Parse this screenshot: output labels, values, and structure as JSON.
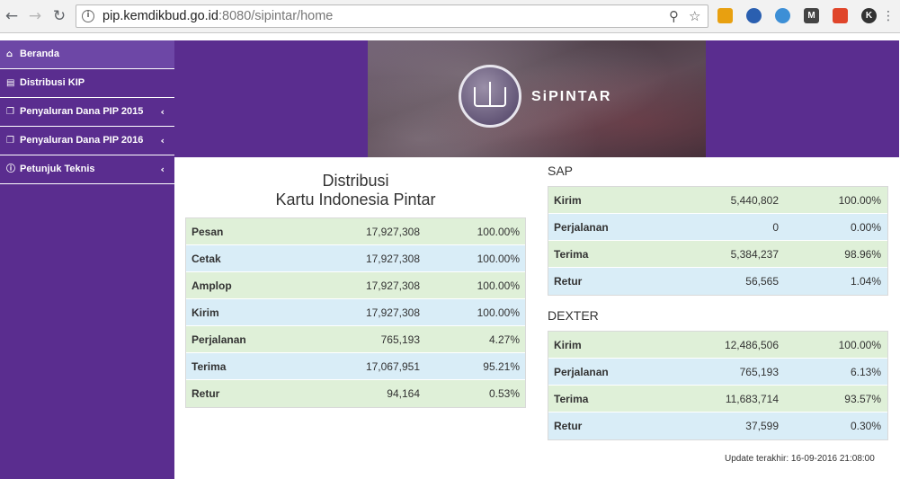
{
  "browser": {
    "url_host": "pip.kemdikbud.go.id",
    "url_rest": ":8080/sipintar/home"
  },
  "sidebar": {
    "items": [
      {
        "label": "Beranda",
        "icon": "home-icon"
      },
      {
        "label": "Distribusi KIP",
        "icon": "card-icon"
      },
      {
        "label": "Penyaluran Dana PIP 2015",
        "icon": "copy-icon"
      },
      {
        "label": "Penyaluran Dana PIP 2016",
        "icon": "copy-icon"
      },
      {
        "label": "Petunjuk Teknis",
        "icon": "info-icon"
      }
    ]
  },
  "banner": {
    "logo_text": "SiPINTAR"
  },
  "kip": {
    "title_line1": "Distribusi",
    "title_line2": "Kartu Indonesia Pintar",
    "rows": [
      {
        "label": "Pesan",
        "value": "17,927,308",
        "pct": "100.00%"
      },
      {
        "label": "Cetak",
        "value": "17,927,308",
        "pct": "100.00%"
      },
      {
        "label": "Amplop",
        "value": "17,927,308",
        "pct": "100.00%"
      },
      {
        "label": "Kirim",
        "value": "17,927,308",
        "pct": "100.00%"
      },
      {
        "label": "Perjalanan",
        "value": "765,193",
        "pct": "4.27%"
      },
      {
        "label": "Terima",
        "value": "17,067,951",
        "pct": "95.21%"
      },
      {
        "label": "Retur",
        "value": "94,164",
        "pct": "0.53%"
      }
    ]
  },
  "sap": {
    "title": "SAP",
    "rows": [
      {
        "label": "Kirim",
        "value": "5,440,802",
        "pct": "100.00%"
      },
      {
        "label": "Perjalanan",
        "value": "0",
        "pct": "0.00%"
      },
      {
        "label": "Terima",
        "value": "5,384,237",
        "pct": "98.96%"
      },
      {
        "label": "Retur",
        "value": "56,565",
        "pct": "1.04%"
      }
    ]
  },
  "dexter": {
    "title": "DEXTER",
    "rows": [
      {
        "label": "Kirim",
        "value": "12,486,506",
        "pct": "100.00%"
      },
      {
        "label": "Perjalanan",
        "value": "765,193",
        "pct": "6.13%"
      },
      {
        "label": "Terima",
        "value": "11,683,714",
        "pct": "93.57%"
      },
      {
        "label": "Retur",
        "value": "37,599",
        "pct": "0.30%"
      }
    ]
  },
  "footer": {
    "update": "Update terakhir: 16-09-2016 21:08:00"
  },
  "colors": {
    "purple": "#5a2d8f",
    "active": "#6d47a6",
    "green_row": "#dff0d8",
    "blue_row": "#d9edf7"
  }
}
